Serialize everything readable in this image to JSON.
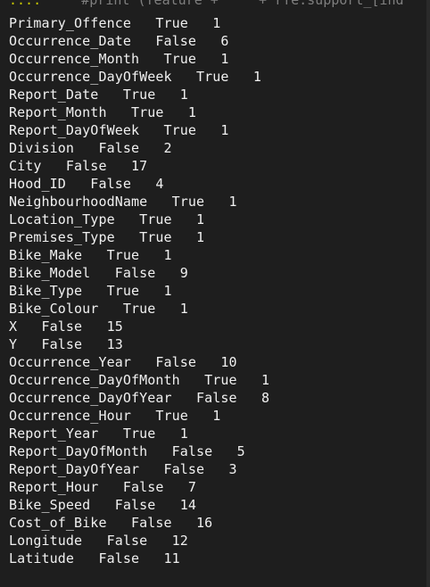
{
  "prompt": {
    "marker": "...:",
    "code": "     #print (feature + ' ' + rfe.support_[ind"
  },
  "rows": [
    "Primary_Offence   True   1",
    "Occurrence_Date   False   6",
    "Occurrence_Month   True   1",
    "Occurrence_DayOfWeek   True   1",
    "Report_Date   True   1",
    "Report_Month   True   1",
    "Report_DayOfWeek   True   1",
    "Division   False   2",
    "City   False   17",
    "Hood_ID   False   4",
    "NeighbourhoodName   True   1",
    "Location_Type   True   1",
    "Premises_Type   True   1",
    "Bike_Make   True   1",
    "Bike_Model   False   9",
    "Bike_Type   True   1",
    "Bike_Colour   True   1",
    "X   False   15",
    "Y   False   13",
    "Occurrence_Year   False   10",
    "Occurrence_DayOfMonth   True   1",
    "Occurrence_DayOfYear   False   8",
    "Occurrence_Hour   True   1",
    "Report_Year   True   1",
    "Report_DayOfMonth   False   5",
    "Report_DayOfYear   False   3",
    "Report_Hour   False   7",
    "Bike_Speed   False   14",
    "Cost_of_Bike   False   16",
    "Longitude   False   12",
    "Latitude   False   11"
  ]
}
